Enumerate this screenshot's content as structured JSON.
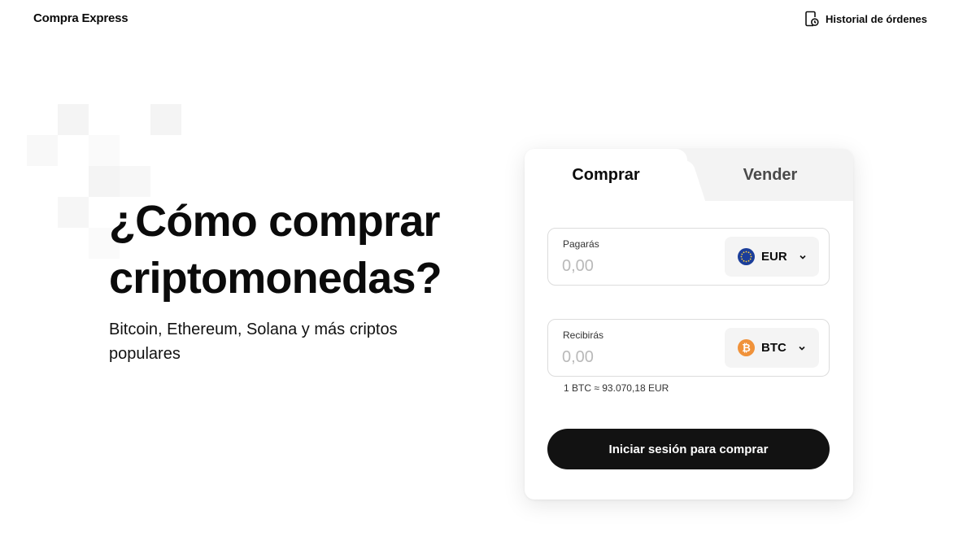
{
  "header": {
    "brand": "Compra Express",
    "history_label": "Historial de órdenes",
    "history_icon": "order-history-icon"
  },
  "hero": {
    "title": "¿Cómo comprar criptomonedas?",
    "subtitle": "Bitcoin, Ethereum, Solana y más criptos populares"
  },
  "widget": {
    "tabs": [
      {
        "label": "Comprar",
        "active": true
      },
      {
        "label": "Vender",
        "active": false
      }
    ],
    "pay": {
      "label": "Pagarás",
      "placeholder": "0,00",
      "currency": "EUR",
      "currency_icon": "eur-flag-icon",
      "currency_color": "#1b3e9a"
    },
    "receive": {
      "label": "Recibirás",
      "placeholder": "0,00",
      "currency": "BTC",
      "currency_icon": "btc-icon",
      "currency_color": "#f0923a"
    },
    "rate": "1 BTC ≈ 93.070,18 EUR",
    "cta": "Iniciar sesión para comprar"
  },
  "colors": {
    "accent": "#121212",
    "tab_inactive_bg": "#f3f3f3",
    "decor_pixel": "#f5f5f5"
  }
}
